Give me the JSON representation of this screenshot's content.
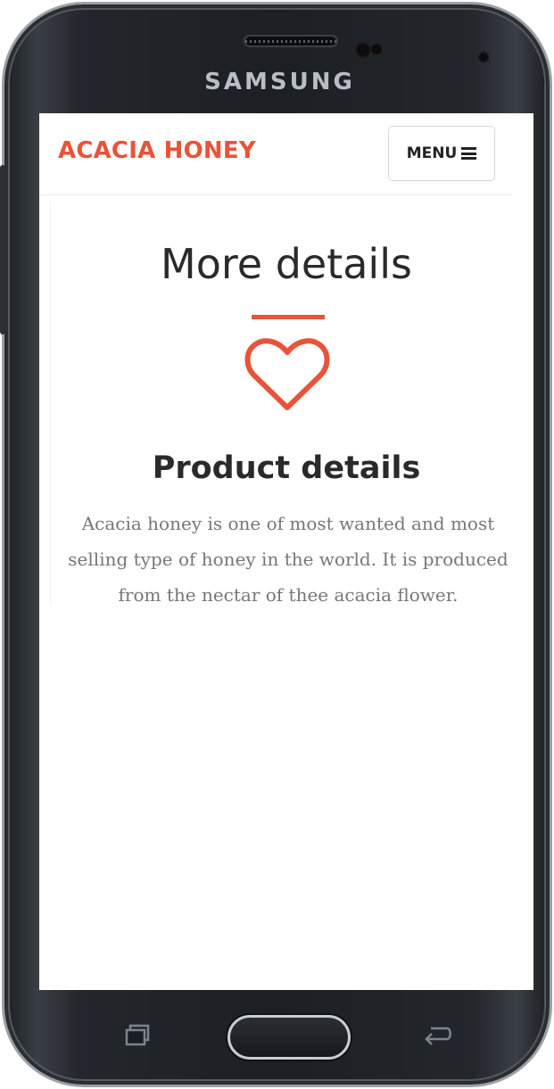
{
  "device": {
    "brand": "SAMSUNG"
  },
  "navbar": {
    "site_title": "ACACIA HONEY",
    "menu_label": "MENU"
  },
  "section": {
    "title": "More details"
  },
  "feature": {
    "icon": "heart-icon",
    "title": "Product details",
    "text": "Acacia honey is one of most wanted and most selling type of honey in the world. It is produced from the nectar of thee acacia flower."
  },
  "colors": {
    "accent": "#e8533a",
    "heading": "#2a2a2a",
    "body_text": "#777777"
  }
}
